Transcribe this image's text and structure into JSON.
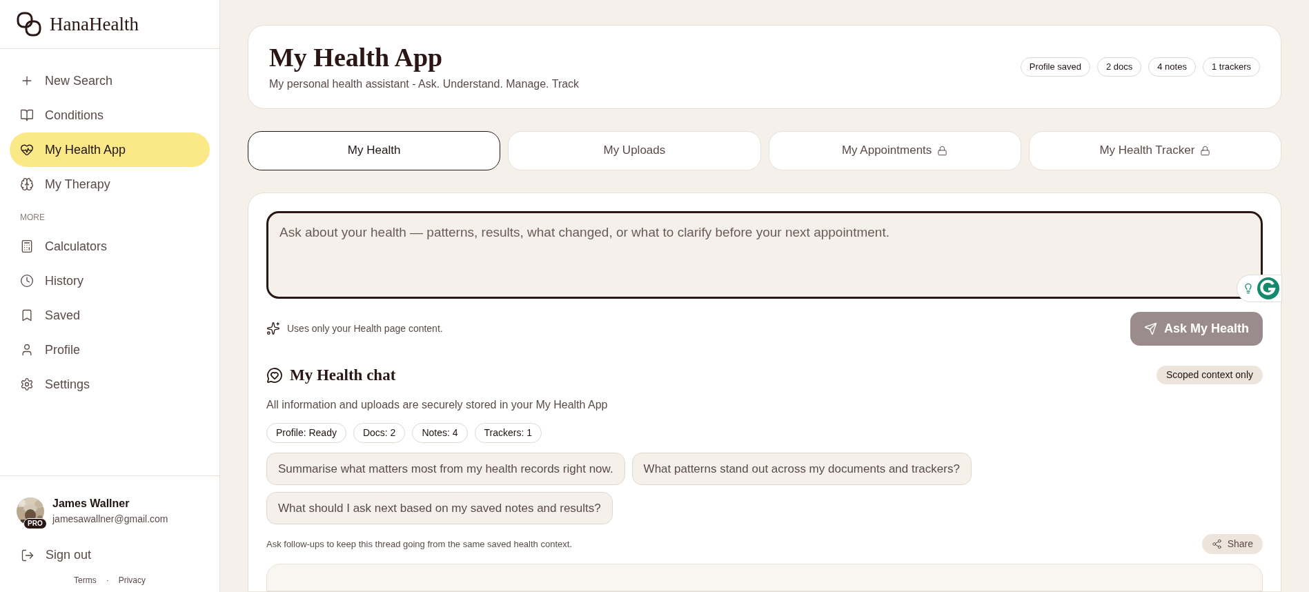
{
  "brand": "HanaHealth",
  "sidebar": {
    "items": [
      {
        "kind": "plus",
        "label": "New Search",
        "selected": false
      },
      {
        "kind": "book",
        "label": "Conditions",
        "selected": false
      },
      {
        "kind": "heart",
        "label": "My Health App",
        "selected": true
      },
      {
        "kind": "brain",
        "label": "My Therapy",
        "selected": false
      }
    ],
    "section": "MORE",
    "more_items": [
      {
        "kind": "calculator",
        "label": "Calculators",
        "selected": false
      },
      {
        "kind": "clock",
        "label": "History",
        "selected": false
      },
      {
        "kind": "bookmark",
        "label": "Saved",
        "selected": false
      },
      {
        "kind": "user",
        "label": "Profile",
        "selected": false
      },
      {
        "kind": "gear",
        "label": "Settings",
        "selected": false
      }
    ],
    "user": {
      "name": "James Wallner",
      "email": "jamesawallner@gmail.com",
      "badge": "PRO"
    },
    "sign_out": "Sign out",
    "footer_links": [
      "Terms",
      "Privacy"
    ],
    "footer_separator": "·"
  },
  "header": {
    "title": "My Health App",
    "subtitle": "My personal health assistant - Ask. Understand. Manage. Track",
    "badges": [
      "Profile saved",
      "2 docs",
      "4 notes",
      "1 trackers"
    ]
  },
  "tabs": [
    {
      "label": "My Health",
      "selected": true,
      "locked": false
    },
    {
      "label": "My Uploads",
      "selected": false,
      "locked": false
    },
    {
      "label": "My Appointments",
      "selected": false,
      "locked": true
    },
    {
      "label": "My Health Tracker",
      "selected": false,
      "locked": true
    }
  ],
  "ask": {
    "placeholder": "Ask about your health — patterns, results, what changed, or what to clarify before your next appointment.",
    "note": "Uses only your Health page content.",
    "button": "Ask My Health",
    "disabled": true
  },
  "chat": {
    "title": "My Health chat",
    "badge": "Scoped context only",
    "description": "All information and uploads are securely stored in your My Health App",
    "stats": [
      "Profile: Ready",
      "Docs: 2",
      "Notes: 4",
      "Trackers: 1"
    ],
    "suggestions": [
      "Summarise what matters most from my health records right now.",
      "What patterns stand out across my documents and trackers?",
      "What should I ask next based on my saved notes and results?"
    ],
    "hint": "Ask follow-ups to keep this thread going from the same saved health context.",
    "share": "Share"
  }
}
